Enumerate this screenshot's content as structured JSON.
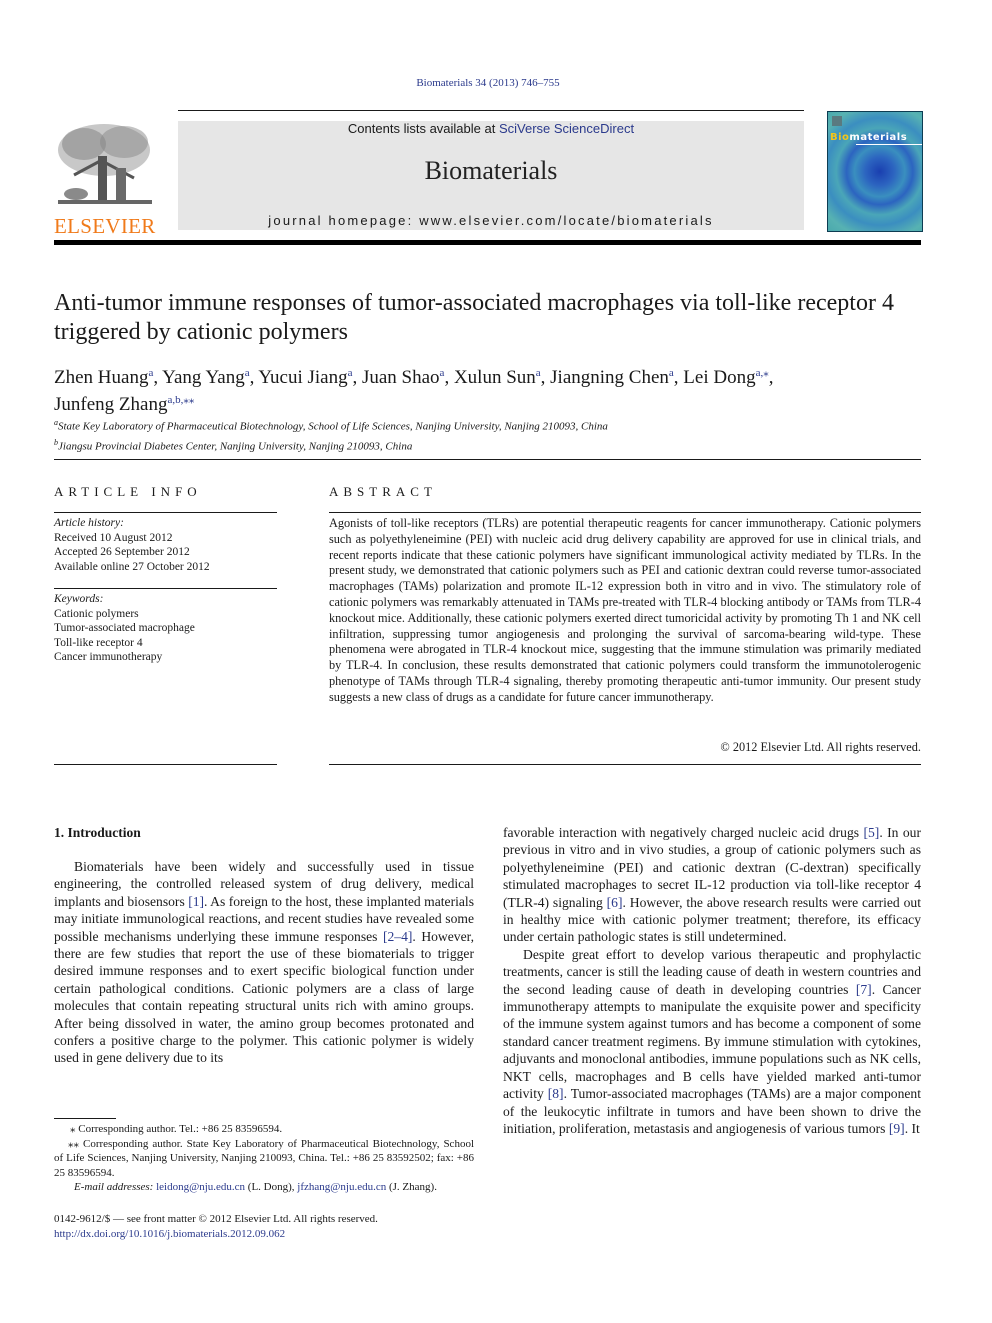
{
  "header": {
    "journal_ref": "Biomaterials 34 (2013) 746–755",
    "contents_prefix": "Contents lists available at ",
    "contents_link": "SciVerse ScienceDirect",
    "journal_title": "Biomaterials",
    "homepage": "journal homepage: www.elsevier.com/locate/biomaterials",
    "publisher_logo_text": "ELSEVIER",
    "cover_title_highlight": "Bio",
    "cover_title_rest": "materials",
    "logo_color": "#f07a1a",
    "link_color": "#2b3a8c"
  },
  "article": {
    "title": "Anti-tumor immune responses of tumor-associated macrophages via toll-like receptor 4 triggered by cationic polymers",
    "authors": [
      {
        "name": "Zhen Huang",
        "sup": "a",
        "sep": ", "
      },
      {
        "name": "Yang Yang",
        "sup": "a",
        "sep": ", "
      },
      {
        "name": "Yucui Jiang",
        "sup": "a",
        "sep": ", "
      },
      {
        "name": "Juan Shao",
        "sup": "a",
        "sep": ", "
      },
      {
        "name": "Xulun Sun",
        "sup": "a",
        "sep": ", "
      },
      {
        "name": "Jiangning Chen",
        "sup": "a",
        "sep": ", "
      },
      {
        "name": "Lei Dong",
        "sup": "a,⁎",
        "sep": ","
      },
      {
        "name": "Junfeng Zhang",
        "sup": "a,b,⁎⁎",
        "sep": ""
      }
    ],
    "affiliations": [
      {
        "sup": "a",
        "text": "State Key Laboratory of Pharmaceutical Biotechnology, School of Life Sciences, Nanjing University, Nanjing 210093, China"
      },
      {
        "sup": "b",
        "text": "Jiangsu Provincial Diabetes Center, Nanjing University, Nanjing 210093, China"
      }
    ]
  },
  "article_info": {
    "heading": "ARTICLE INFO",
    "history_label": "Article history:",
    "history": [
      "Received 10 August 2012",
      "Accepted 26 September 2012",
      "Available online 27 October 2012"
    ],
    "keywords_label": "Keywords:",
    "keywords": [
      "Cationic polymers",
      "Tumor-associated macrophage",
      "Toll-like receptor 4",
      "Cancer immunotherapy"
    ]
  },
  "abstract": {
    "heading": "ABSTRACT",
    "text": "Agonists of toll-like receptors (TLRs) are potential therapeutic reagents for cancer immunotherapy. Cationic polymers such as polyethyleneimine (PEI) with nucleic acid drug delivery capability are approved for use in clinical trials, and recent reports indicate that these cationic polymers have signif­icant immunological activity mediated by TLRs. In the present study, we demonstrated that cationic polymers such as PEI and cationic dextran could reverse tumor-associated macrophages (TAMs) polar­ization and promote IL-12 expression both in vitro and in vivo. The stimulatory role of cationic polymers was remarkably attenuated in TAMs pre-treated with TLR-4 blocking antibody or TAMs from TLR-4 knockout mice. Additionally, these cationic polymers exerted direct tumoricidal activity by promoting Th 1 and NK cell infiltration, suppressing tumor angiogenesis and prolonging the survival of sarcoma-bearing wild-type. These phenomena were abrogated in TLR-4 knockout mice, suggesting that the immune stimulation was primarily mediated by TLR-4. In conclusion, these results demonstrated that cationic polymers could transform the immunotolerogenic phenotype of TAMs through TLR-4 signaling, thereby promoting therapeutic anti-tumor immunity. Our present study suggests a new class of drugs as a candidate for future cancer immunotherapy.",
    "copyright": "© 2012 Elsevier Ltd. All rights reserved."
  },
  "body": {
    "section_heading": "1.  Introduction",
    "left_p1": [
      {
        "t": "Biomaterials have been widely and successfully used in tissue engineering, the controlled released system of drug delivery, medical implants and biosensors "
      },
      {
        "ref": "[1]"
      },
      {
        "t": ". As foreign to the host, these implanted materials may initiate immunological reactions, and recent studies have revealed some possible mechanisms under­lying these immune responses "
      },
      {
        "ref": "[2–4]"
      },
      {
        "t": ". However, there are few studies that report the use of these biomaterials to trigger desired immune responses and to exert specific biological function under certain pathological conditions. Cationic polymers are a class of large molecules that contain repeating structural units rich with amino groups. After being dissolved in water, the amino group becomes protonated and confers a positive charge to the polymer. This cationic polymer is widely used in gene delivery due to its"
      }
    ],
    "right_p1": [
      {
        "t": "favorable interaction with negatively charged nucleic acid drugs "
      },
      {
        "ref": "[5]"
      },
      {
        "t": ". In our previous in vitro and in vivo studies, a group of cationic polymers such as polyethyleneimine (PEI) and cationic dextran (C-dextran) specifically stimulated macrophages to secret IL-12 production via toll-like receptor 4 (TLR-4) signaling "
      },
      {
        "ref": "[6]"
      },
      {
        "t": ". However, the above research results were carried out in healthy mice with cationic polymer treatment; therefore, its efficacy under certain pathologic states is still undetermined."
      }
    ],
    "right_p2": [
      {
        "t": "Despite great effort to develop various therapeutic and prophylactic treatments, cancer is still the leading cause of death in western countries and the second leading cause of death in developing countries "
      },
      {
        "ref": "[7]"
      },
      {
        "t": ". Cancer immunotherapy attempts to manipulate the exquisite power and specificity of the immune system against tumors and has become a component of some standard cancer treatment regimens. By immune stimulation with cytokines, adjuvants and monoclonal antibodies, immune pop­ulations such as NK cells, NKT cells, macrophages and B cells have yielded marked anti-tumor activity "
      },
      {
        "ref": "[8]"
      },
      {
        "t": ". Tumor-associated macrophages (TAMs) are a major component of the leukocytic infiltrate in tumors and have been shown to drive the initiation, proliferation, metastasis and angiogenesis of various tumors "
      },
      {
        "ref": "[9]"
      },
      {
        "t": ". It"
      }
    ]
  },
  "footnotes": {
    "fn1": "⁎ Corresponding author. Tel.: +86 25 83596594.",
    "fn2": "⁎⁎ Corresponding author. State Key Laboratory of Pharmaceutical Biotechnology, School of Life Sciences, Nanjing University, Nanjing 210093, China. Tel.: +86 25 83592502; fax: +86 25 83596594.",
    "email_label": "E-mail addresses:",
    "email1": "leidong@nju.edu.cn",
    "email1_who": " (L. Dong), ",
    "email2": "jfzhang@nju.edu.cn",
    "email2_who": " (J. Zhang).",
    "issn_line": "0142-9612/$ — see front matter © 2012 Elsevier Ltd. All rights reserved.",
    "doi": "http://dx.doi.org/10.1016/j.biomaterials.2012.09.062"
  }
}
